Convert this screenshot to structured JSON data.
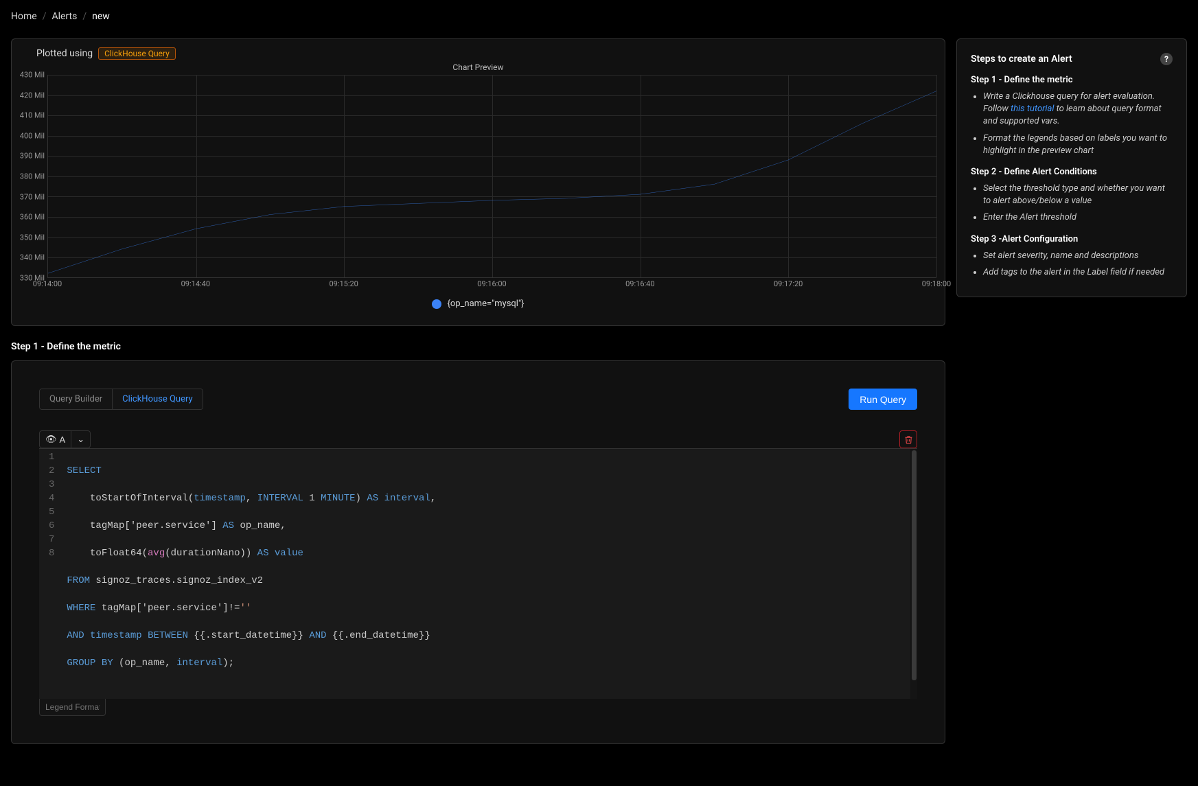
{
  "breadcrumb": {
    "home": "Home",
    "alerts": "Alerts",
    "current": "new"
  },
  "chart_panel": {
    "plotted_label": "Plotted using",
    "mode_tag": "ClickHouse Query",
    "title": "Chart Preview",
    "legend": "{op_name=\"mysql\"}"
  },
  "chart_data": {
    "type": "line",
    "title": "Chart Preview",
    "xlabel": "",
    "ylabel": "",
    "ylim": [
      330000000,
      430000000
    ],
    "y_ticks": [
      "330 Mil",
      "340 Mil",
      "350 Mil",
      "360 Mil",
      "370 Mil",
      "380 Mil",
      "390 Mil",
      "400 Mil",
      "410 Mil",
      "420 Mil",
      "430 Mil"
    ],
    "x_ticks": [
      "09:14:00",
      "09:14:40",
      "09:15:20",
      "09:16:00",
      "09:16:40",
      "09:17:20",
      "09:18:00"
    ],
    "series": [
      {
        "name": "{op_name=\"mysql\"}",
        "color": "#3b82f6",
        "x": [
          "09:14:00",
          "09:14:20",
          "09:14:40",
          "09:15:00",
          "09:15:20",
          "09:15:40",
          "09:16:00",
          "09:16:20",
          "09:16:40",
          "09:17:00",
          "09:17:20",
          "09:17:40",
          "09:18:00"
        ],
        "values": [
          332000000,
          344000000,
          354000000,
          361000000,
          365000000,
          366500000,
          368000000,
          369000000,
          371000000,
          376000000,
          388000000,
          406000000,
          422000000
        ]
      }
    ]
  },
  "steps": {
    "title": "Steps to create an Alert",
    "s1_title": "Step 1 - Define the metric",
    "s1_b1_pre": "Write a Clickhouse query for alert evaluation. Follow ",
    "s1_b1_link": "this tutorial",
    "s1_b1_post": " to learn about query format and supported vars.",
    "s1_b2": "Format the legends based on labels you want to highlight in the preview chart",
    "s2_title": "Step 2 - Define Alert Conditions",
    "s2_b1": "Select the threshold type and whether you want to alert above/below a value",
    "s2_b2": "Enter the Alert threshold",
    "s3_title": "Step 3 -Alert Configuration",
    "s3_b1": "Set alert severity, name and descriptions",
    "s3_b2": "Add tags to the alert in the Label field if needed"
  },
  "section_title": "Step 1 - Define the metric",
  "editor": {
    "tab_qb": "Query Builder",
    "tab_ch": "ClickHouse Query",
    "run": "Run Query",
    "query_label": "A",
    "legend_placeholder": "Legend Format",
    "lines": {
      "l1": "SELECT",
      "l2_a": "    toStartOfInterval(",
      "l2_b": "timestamp",
      "l2_c": ", ",
      "l2_d": "INTERVAL",
      "l2_e": " 1 ",
      "l2_f": "MINUTE",
      "l2_g": ") ",
      "l2_h": "AS",
      "l2_i": " ",
      "l2_j": "interval",
      "l2_k": ",",
      "l3_a": "    tagMap['peer.service'] ",
      "l3_b": "AS",
      "l3_c": " op_name,",
      "l4_a": "    toFloat64(",
      "l4_b": "avg",
      "l4_c": "(durationNano)) ",
      "l4_d": "AS",
      "l4_e": " ",
      "l4_f": "value",
      "l5_a": "FROM",
      "l5_b": " signoz_traces.signoz_index_v2",
      "l6_a": "WHERE",
      "l6_b": " tagMap['peer.service']!=",
      "l6_c": "''",
      "l7_a": "AND",
      "l7_b": " ",
      "l7_c": "timestamp",
      "l7_d": " ",
      "l7_e": "BETWEEN",
      "l7_f": " {{.start_datetime}} ",
      "l7_g": "AND",
      "l7_h": " {{.end_datetime}}",
      "l8_a": "GROUP",
      "l8_b": " ",
      "l8_c": "BY",
      "l8_d": " (op_name, ",
      "l8_e": "interval",
      "l8_f": ");"
    }
  }
}
